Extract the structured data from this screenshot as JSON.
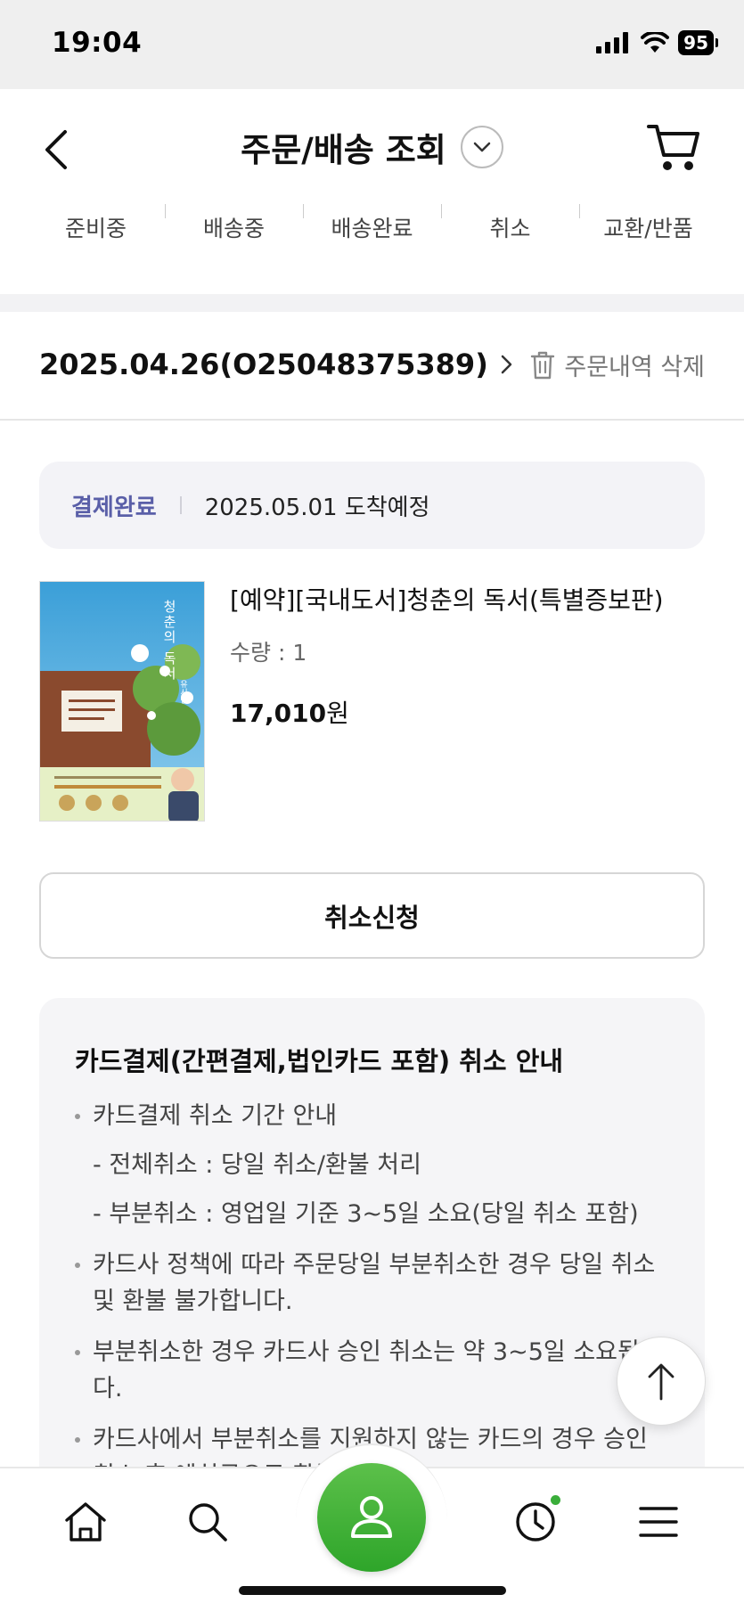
{
  "status_bar": {
    "time": "19:04",
    "battery": "95"
  },
  "header": {
    "title": "주문/배송 조회",
    "tabs": [
      {
        "label": "준비중"
      },
      {
        "label": "배송중"
      },
      {
        "label": "배송완료"
      },
      {
        "label": "취소"
      },
      {
        "label": "교환/반품"
      }
    ]
  },
  "order": {
    "id_text": "2025.04.26(O25048375389)",
    "delete_label": "주문내역 삭제",
    "payment_status": "결제완료",
    "arrival_text": "2025.05.01 도착예정",
    "product": {
      "title": "[예약][국내도서]청춘의 독서(특별증보판)",
      "quantity": "수량 : 1",
      "price": "17,010",
      "currency": "원",
      "cover_title": "청춘의 독서",
      "cover_author": "유시민"
    },
    "cancel_button": "취소신청"
  },
  "notice": {
    "title": "카드결제(간편결제,법인카드 포함) 취소 안내",
    "item1": "카드결제 취소 기간 안내",
    "sub1": "- 전체취소 : 당일 취소/환불 처리",
    "sub2": "- 부분취소 : 영업일 기준 3~5일 소요(당일 취소 포함)",
    "item2": "카드사 정책에 따라 주문당일 부분취소한 경우 당일 취소 및 환불 불가합니다.",
    "item3": "부분취소한 경우 카드사 승인 취소는 약 3~5일 소요됩니다.",
    "item4": "카드사에서 부분취소를 지원하지 않는 카드의 경우 승인취소 후 예치금으로 환불됩니다."
  },
  "colors": {
    "accent_green": "#3aae3a",
    "pay_status": "#5a5fa8"
  },
  "icons": {
    "back": "chevron-left-icon",
    "dropdown": "chevron-down-icon",
    "cart": "cart-icon",
    "trash": "trash-icon",
    "top": "arrow-up-icon",
    "home": "home-icon",
    "search": "search-icon",
    "my": "user-icon",
    "recent": "clock-icon",
    "menu": "hamburger-menu-icon"
  }
}
